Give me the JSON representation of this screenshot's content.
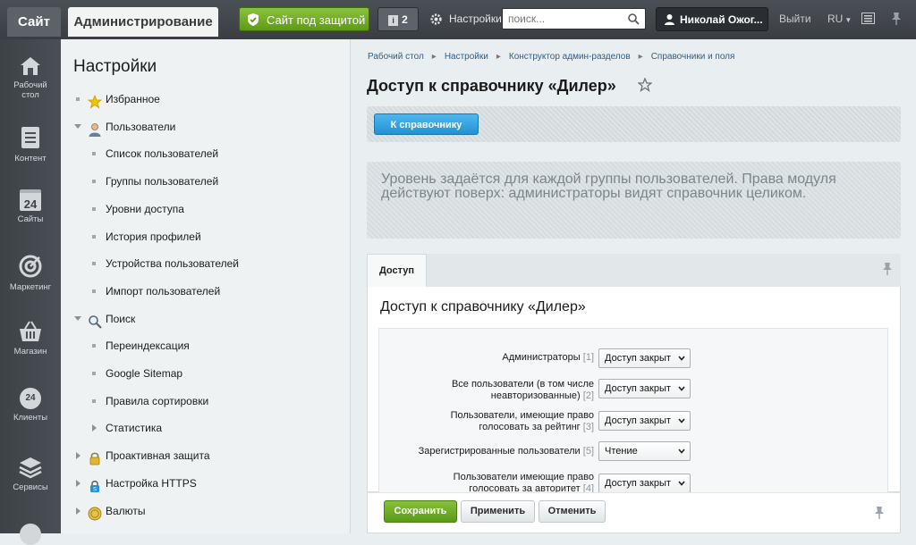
{
  "topbar": {
    "site_tab": "Сайт",
    "admin_tab": "Администрирование",
    "protect_label": "Сайт под защитой",
    "notify_count": "2",
    "settings_label": "Настройки",
    "search_placeholder": "поиск...",
    "user_name": "Николай Ожог...",
    "logout_label": "Выйти",
    "lang_label": "RU"
  },
  "leftnav": {
    "items": [
      {
        "label": "Рабочий стол",
        "icon": "home-icon"
      },
      {
        "label": "Контент",
        "icon": "document-icon"
      },
      {
        "label": "Сайты",
        "icon": "calendar-icon"
      },
      {
        "label": "Маркетинг",
        "icon": "target-icon"
      },
      {
        "label": "Магазин",
        "icon": "basket-icon"
      },
      {
        "label": "Клиенты",
        "icon": "clients-icon"
      },
      {
        "label": "Сервисы",
        "icon": "layers-icon"
      }
    ],
    "sites_day": "24",
    "clients_day": "24"
  },
  "menu": {
    "title": "Настройки",
    "items": [
      {
        "label": "Избранное",
        "icon": "star-icon",
        "kind": "top"
      },
      {
        "label": "Пользователи",
        "icon": "user-icon",
        "kind": "expanded"
      },
      {
        "label": "Список пользователей",
        "kind": "sub"
      },
      {
        "label": "Группы пользователей",
        "kind": "sub"
      },
      {
        "label": "Уровни доступа",
        "kind": "sub"
      },
      {
        "label": "История профилей",
        "kind": "sub"
      },
      {
        "label": "Устройства пользователей",
        "kind": "sub"
      },
      {
        "label": "Импорт пользователей",
        "kind": "sub"
      },
      {
        "label": "Поиск",
        "icon": "search-icon",
        "kind": "expanded"
      },
      {
        "label": "Переиндексация",
        "kind": "sub"
      },
      {
        "label": "Google Sitemap",
        "kind": "sub"
      },
      {
        "label": "Правила сортировки",
        "kind": "sub"
      },
      {
        "label": "Статистика",
        "kind": "subcollapsed"
      },
      {
        "label": "Проактивная защита",
        "icon": "lock-icon",
        "kind": "collapsed"
      },
      {
        "label": "Настройка HTTPS",
        "icon": "https-icon",
        "kind": "collapsed"
      },
      {
        "label": "Валюты",
        "icon": "currency-icon",
        "kind": "collapsed"
      }
    ]
  },
  "content": {
    "breadcrumbs": [
      "Рабочий стол",
      "Настройки",
      "Конструктор админ-разделов",
      "Справочники и поля"
    ],
    "page_title": "Доступ к справочнику «Дилер»",
    "back_button": "К справочнику",
    "note": "Уровень задаётся для каждой группы пользователей. Права модуля действуют поверх: администраторы видят справочник целиком.",
    "tab_label": "Доступ",
    "panel_title": "Доступ к справочнику «Дилер»",
    "rows": [
      {
        "label": "Администраторы",
        "num": "[1]",
        "value": "Доступ закрыт"
      },
      {
        "label": "Все пользователи (в том числе неавторизованные)",
        "num": "[2]",
        "value": "Доступ закрыт"
      },
      {
        "label": "Пользователи, имеющие право голосовать за рейтинг",
        "num": "[3]",
        "value": "Доступ закрыт"
      },
      {
        "label": "Зарегистрированные пользователи",
        "num": "[5]",
        "value": "Чтение"
      },
      {
        "label": "Пользователи имеющие право голосовать за авторитет",
        "num": "[4]",
        "value": "Доступ закрыт"
      }
    ],
    "save_button": "Сохранить",
    "apply_button": "Применить",
    "cancel_button": "Отменить"
  },
  "colors": {
    "accent_green": "#6aa824",
    "accent_blue": "#2b9ee0",
    "topbar_bg": "#3f4449"
  }
}
